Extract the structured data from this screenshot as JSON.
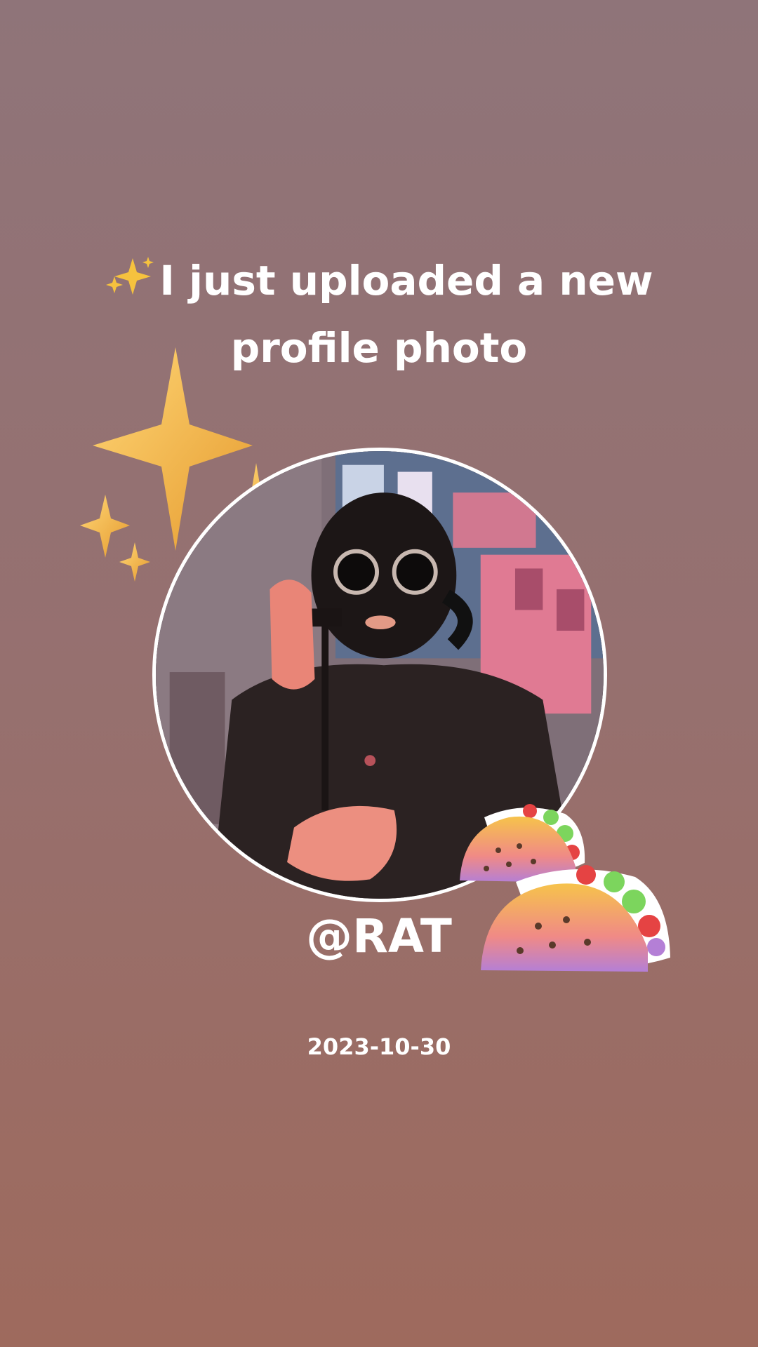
{
  "headline": {
    "emoji": "sparkles-icon",
    "text": "I just uploaded a new profile photo"
  },
  "profile": {
    "handle": "@RAT",
    "date": "2023-10-30"
  },
  "decorations": {
    "top_left": "sparkles-icon",
    "bottom_right": "taco-icon"
  },
  "colors": {
    "background_top": "#8f7479",
    "background_bottom": "#9e6a5d",
    "text": "#ffffff",
    "ring": "#ffffff"
  }
}
